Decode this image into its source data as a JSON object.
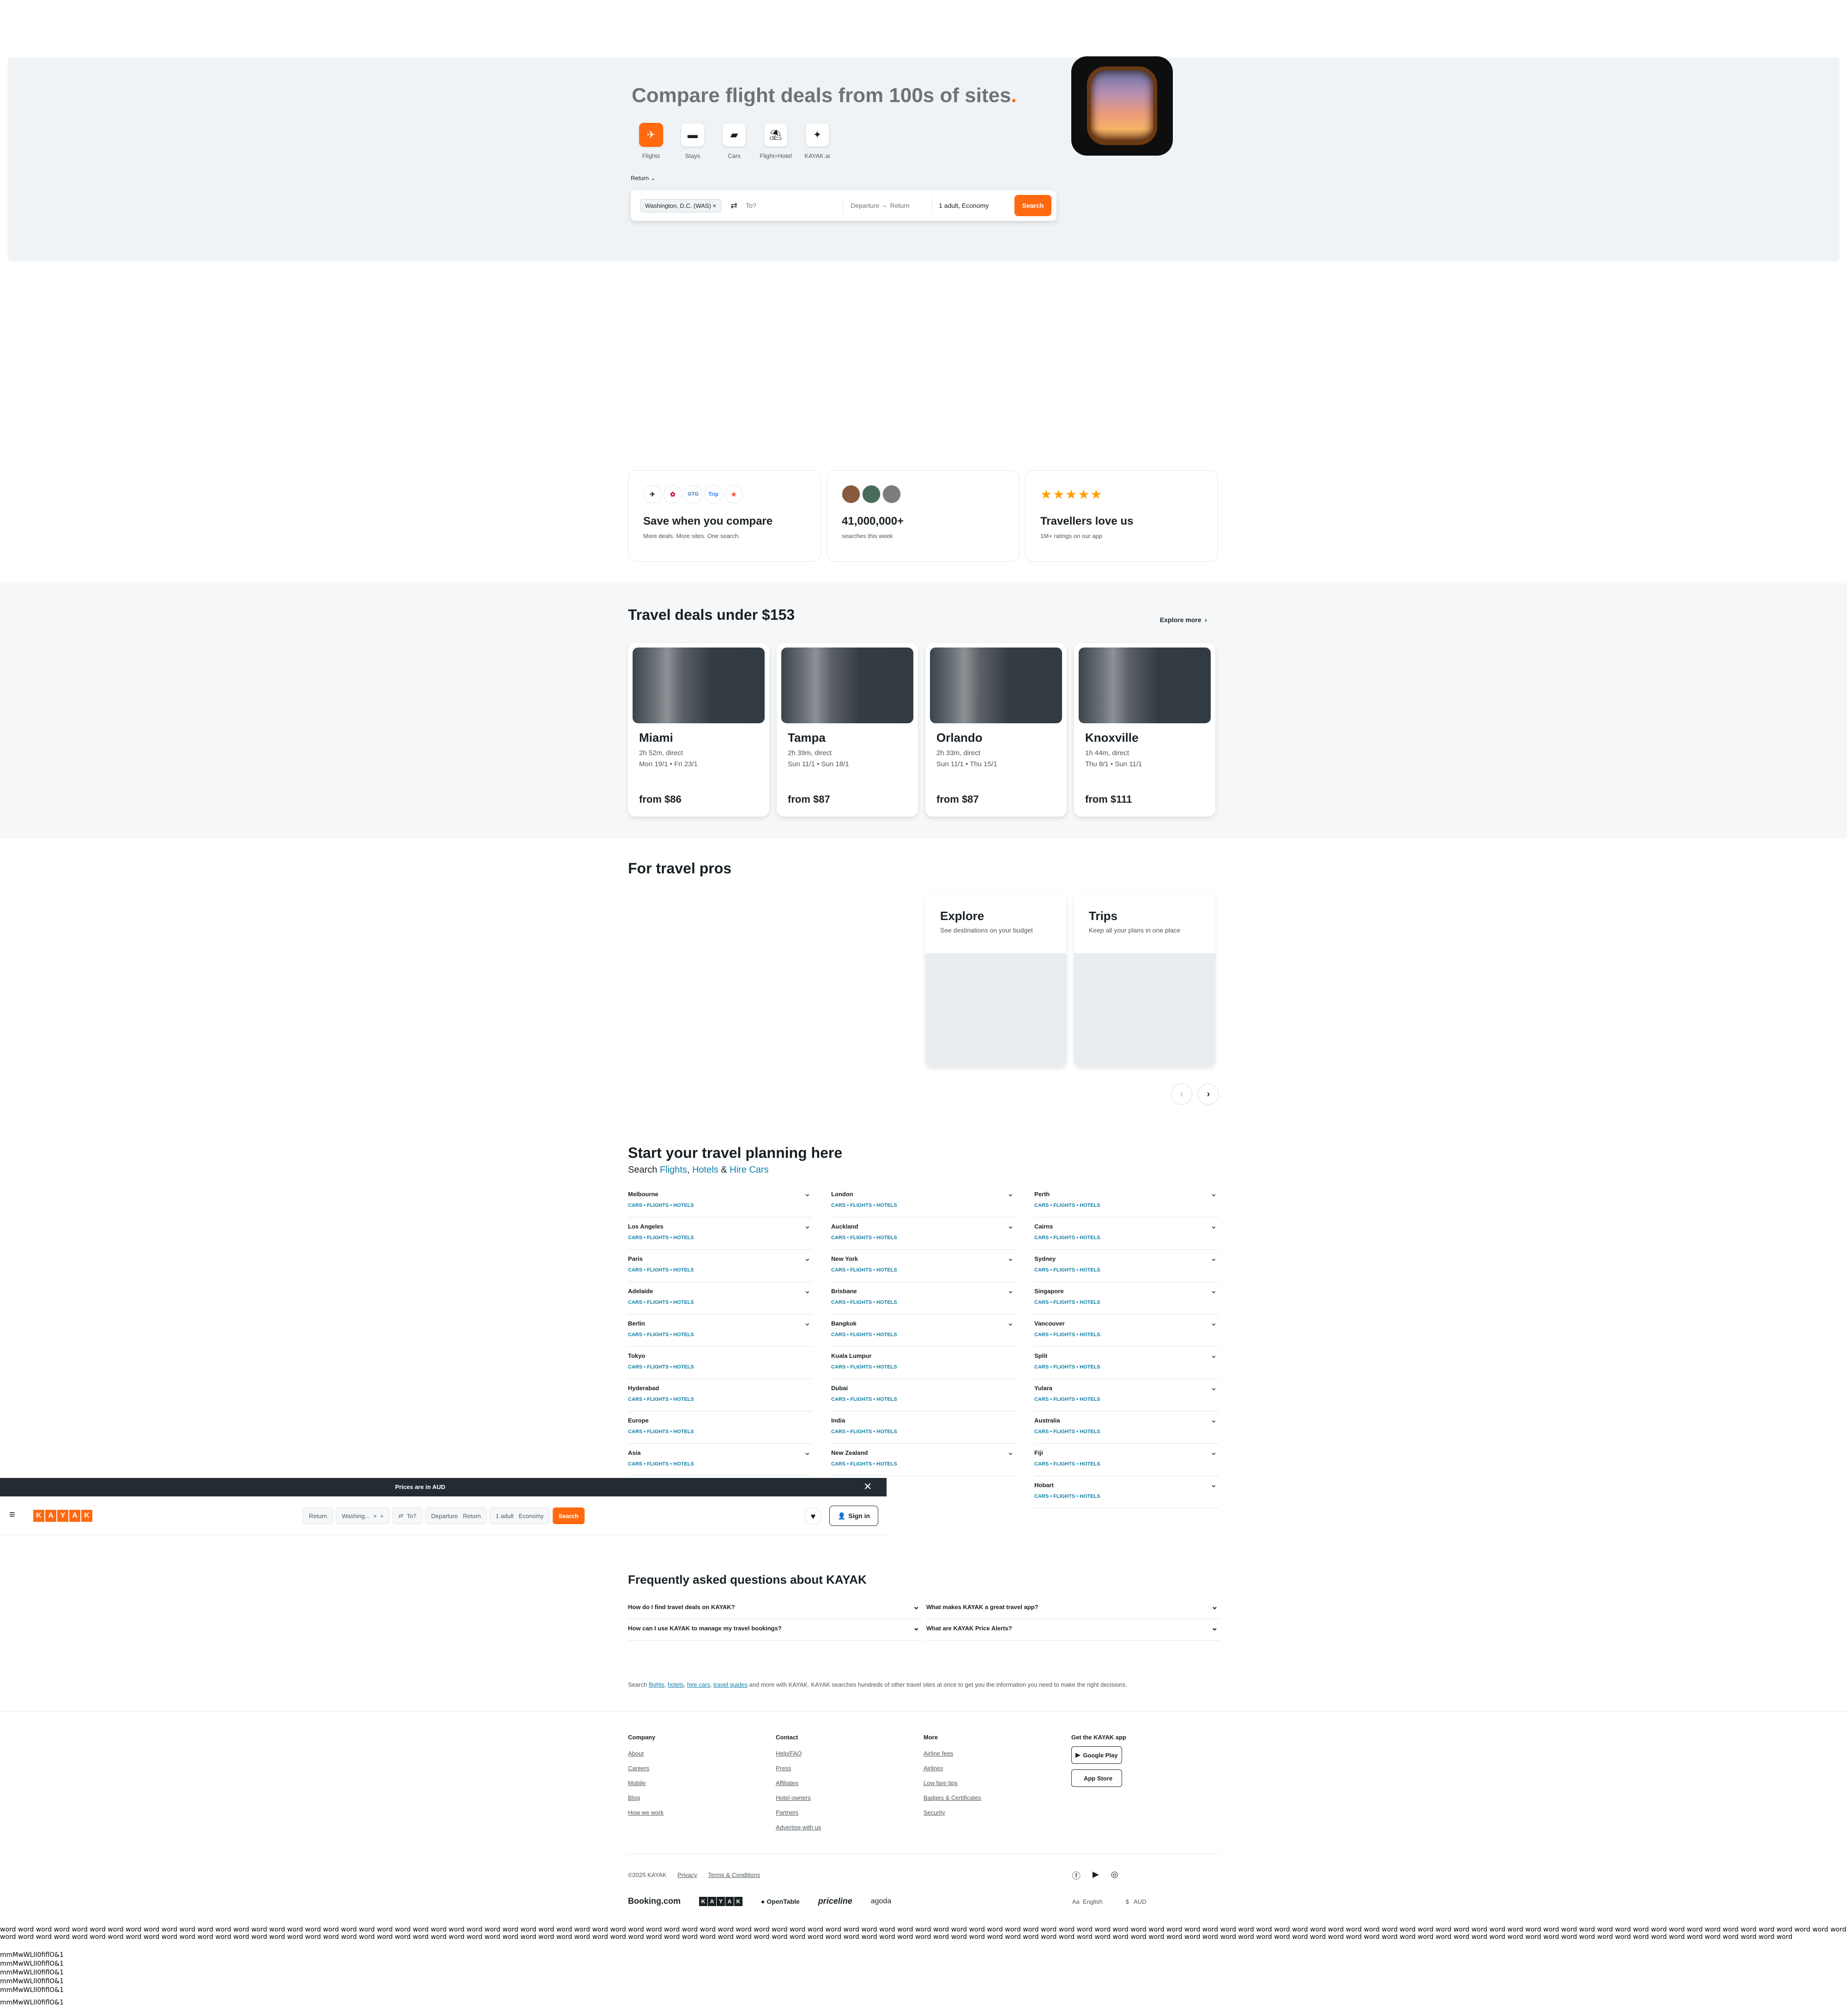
{
  "hero": {
    "title": "Compare flight deals from 100s of sites",
    "title_dot": ".",
    "verticals": [
      {
        "label": "Flights",
        "icon": "plane-icon"
      },
      {
        "label": "Stays",
        "icon": "bed-icon"
      },
      {
        "label": "Cars",
        "icon": "car-icon"
      },
      {
        "label": "Flight+Hotel",
        "icon": "flight-hotel-icon"
      },
      {
        "label": "KAYAK.ai",
        "icon": "ai-sparkle-icon"
      }
    ],
    "trip_type": "Return",
    "search": {
      "origin": "Washington, D.C. (WAS)",
      "destination_placeholder": "To?",
      "departure": "Departure",
      "return": "Return",
      "travellers": "1 adult, Economy",
      "button": "Search"
    }
  },
  "value_props": [
    {
      "title": "Save when you compare",
      "text": "More deals. More sites. One search.",
      "logos": [
        "✈",
        "✿",
        "GTG",
        "Trip",
        "★"
      ]
    },
    {
      "title": "41,000,000+",
      "text": "searches this week"
    },
    {
      "title": "Travellers love us",
      "text": "1M+ ratings on our app",
      "stars": "★★★★★"
    }
  ],
  "deals": {
    "title": "Travel deals under $153",
    "explore": "Explore more",
    "items": [
      {
        "city": "Miami",
        "duration": "2h 52m, direct",
        "dates": "Mon 19/1 • Fri 23/1",
        "price": "from $86"
      },
      {
        "city": "Tampa",
        "duration": "2h 39m, direct",
        "dates": "Sun 11/1 • Sun 18/1",
        "price": "from $87"
      },
      {
        "city": "Orlando",
        "duration": "2h 33m, direct",
        "dates": "Sun 11/1 • Thu 15/1",
        "price": "from $87"
      },
      {
        "city": "Knoxville",
        "duration": "1h 44m, direct",
        "dates": "Thu 8/1 • Sun 11/1",
        "price": "from $111"
      }
    ]
  },
  "pros": {
    "title": "For travel pros",
    "cards": [
      {
        "title": "Explore",
        "text": "See destinations on your budget"
      },
      {
        "title": "Trips",
        "text": "Keep all your plans in one place"
      }
    ]
  },
  "planning": {
    "title": "Start your travel planning here",
    "sub_prefix": "Search",
    "sub_flights": "Flights",
    "sub_comma": ",",
    "sub_hotels": "Hotels",
    "sub_amp": "&",
    "sub_cars": "Hire Cars",
    "item_sub": "CARS • FLIGHTS • HOTELS",
    "col1": [
      "Melbourne",
      "Los Angeles",
      "Paris",
      "Adelaide",
      "Berlin",
      "Tokyo",
      "Hyderabad",
      "Europe",
      "Asia"
    ],
    "col2": [
      "London",
      "Auckland",
      "New York",
      "Brisbane",
      "Bangkok",
      "Kuala Lumpur",
      "Dubai",
      "India",
      "New Zealand"
    ],
    "col3": [
      "Perth",
      "Cairns",
      "Sydney",
      "Singapore",
      "Vancouver",
      "Split",
      "Yulara",
      "Australia",
      "Fiji",
      "Hobart"
    ]
  },
  "notice": {
    "text": "Prices are in AUD"
  },
  "sticky": {
    "logo": [
      "K",
      "A",
      "Y",
      "A",
      "K"
    ],
    "trip": "Return",
    "origin": "Washing...",
    "to": "To?",
    "departure": "Departure",
    "return": "Return",
    "adults": "1 adult",
    "cabin": "Economy",
    "search": "Search",
    "signin": "Sign in"
  },
  "faq": {
    "title": "Frequently asked questions about KAYAK",
    "items": [
      "How do I find travel deals on KAYAK?",
      "What makes KAYAK a great travel app?",
      "How can I use KAYAK to manage my travel bookings?",
      "What are KAYAK Price Alerts?"
    ]
  },
  "seo": {
    "prefix": "Search",
    "links": [
      "flights",
      "hotels",
      "hire cars",
      "travel guides"
    ],
    "suffix": "and more with KAYAK. KAYAK searches hundreds of other travel sites at once to get you the information you need to make the right decisions."
  },
  "footer": {
    "company": {
      "title": "Company",
      "links": [
        "About",
        "Careers",
        "Mobile",
        "Blog",
        "How we work"
      ]
    },
    "contact": {
      "title": "Contact",
      "links": [
        "Help/FAQ",
        "Press",
        "Affiliates",
        "Hotel owners",
        "Partners",
        "Advertise with us"
      ]
    },
    "more": {
      "title": "More",
      "links": [
        "Airline fees",
        "Airlines",
        "Low fare tips",
        "Badges & Certificates",
        "Security"
      ]
    },
    "app": {
      "title": "Get the KAYAK app",
      "google": "Google Play",
      "apple": "App Store"
    },
    "copyright": "©2025 KAYAK",
    "privacy": "Privacy",
    "terms": "Terms & Conditions",
    "brands": [
      "Booking.com",
      "OpenTable",
      "priceline",
      "agoda"
    ],
    "language": "English",
    "currency": "AUD"
  },
  "debug": {
    "words": "word word word word word word word word word word word word word word word word word word word word word word word word word word word word word word word word word word word word word word word word word word word word word word word word word word word word word word word word word word word word word word word word word word word word word word word word word word word word word word word word word word word word word word word word word word word word word word word word word word word word word word word word word word word word word word word word word word word word word word word word word word word word word word word word word word word word word word word word word word word word word word word word word word word word word word word word word word word word word word word word word word word word word word word word word word word word word word word word word word word word word word word word word word word word word word word word word word word word word word word word word word word",
    "lines": [
      "mmMwWLlI0fiflO&1",
      "mmMwWLlI0fiflO&1",
      "mmMwWLlI0fiflO&1",
      "mmMwWLlI0fiflO&1",
      "mmMwWLlI0fiflO&1",
      "mmMwWLlI0fiflO&1"
    ]
  }
}
